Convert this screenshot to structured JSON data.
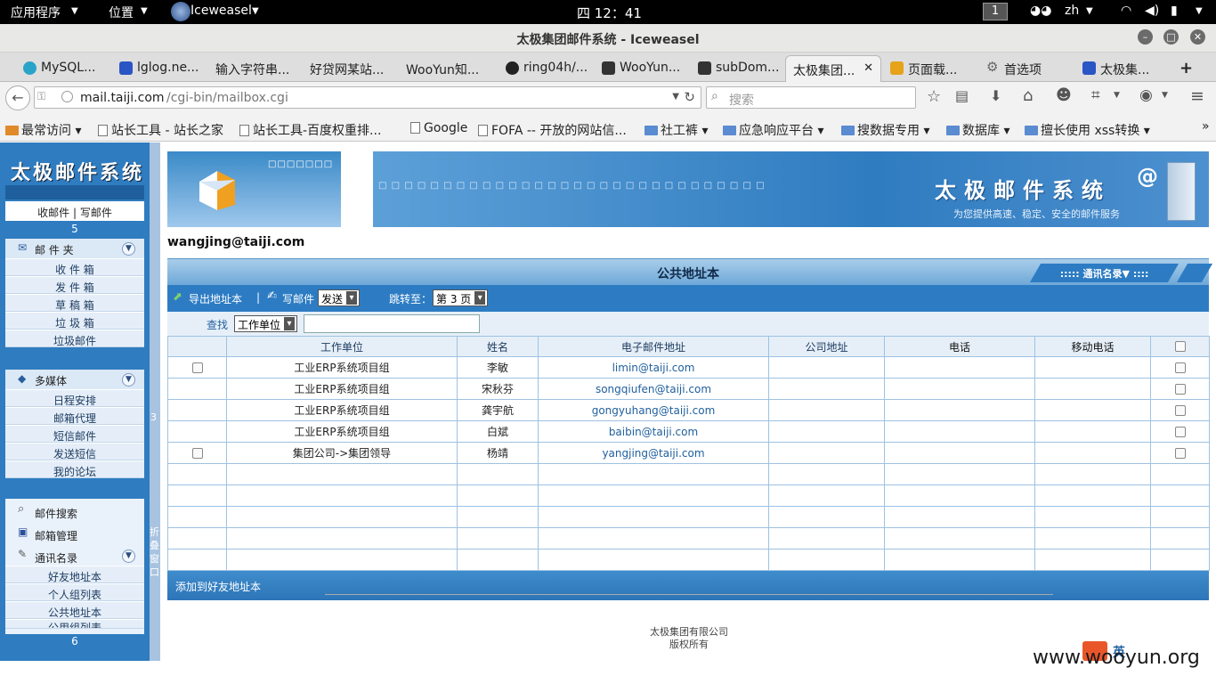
{
  "topbar": {
    "apps": "应用程序",
    "places": "位置",
    "app": "Iceweasel",
    "clock": "四 12：41",
    "workspace": "1",
    "lang": "zh"
  },
  "window": {
    "title": "太极集团邮件系统 - Iceweasel"
  },
  "tabs": [
    "MySQL...",
    "lglog.ne...",
    "输入字符串...",
    "好贷网某站...",
    "WooYun知...",
    "ring04h/...",
    "WooYun...",
    "subDom...",
    "太极集团...",
    "页面载...",
    "首选项",
    "太极集..."
  ],
  "nav": {
    "url_host": "mail.taiji.com",
    "url_path": "/cgi-bin/mailbox.cgi",
    "search_placeholder": "搜索"
  },
  "bookmarks": [
    "最常访问",
    "站长工具 - 站长之家",
    "站长工具-百度权重排...",
    "Google",
    "FOFA -- 开放的网站信...",
    "社工裤",
    "应急响应平台",
    "搜数据专用",
    "数据库",
    "擅长使用 xss转换"
  ],
  "sidebar": {
    "logo": "太极邮件系统",
    "quick": "收邮件 | 写邮件",
    "num1": "5",
    "folders_head": "邮 件 夹",
    "folders": [
      "收 件 箱",
      "发 件 箱",
      "草 稿 箱",
      "垃 圾 箱",
      "垃圾邮件"
    ],
    "media_head": "多媒体",
    "media": [
      "日程安排",
      "邮箱代理",
      "短信邮件",
      "发送短信",
      "我的论坛"
    ],
    "mail_search": "邮件搜索",
    "mailbox_manage": "邮箱管理",
    "contacts_head": "通讯名录",
    "contacts": [
      "好友地址本",
      "个人组列表",
      "公共地址本",
      "公用组列表"
    ],
    "num2": "6",
    "stripe_num": "3",
    "fold_label": "折叠窗口"
  },
  "banner": {
    "title": "太极邮件系统",
    "subtitle": "为您提供高速、稳定、安全的邮件服务",
    "left_boxes": "□□□□□□□",
    "right_boxes": "□ □ □ □ □ □ □ □ □ □ □ □ □ □ □ □ □ □ □ □ □ □ □ □ □ □ □ □ □ □"
  },
  "user": "wangjing@taiji.com",
  "addrbook": {
    "title": "公共地址本",
    "contacts_tab": "::::: 通讯名录▼ ::::",
    "export": "导出地址本",
    "compose": "写邮件",
    "send_option": "发送",
    "jump_label": "跳转至：",
    "page_option": "第 3 页",
    "find_label": "查找",
    "find_field": "工作单位",
    "columns": [
      "工作单位",
      "姓名",
      "电子邮件地址",
      "公司地址",
      "电话",
      "移动电话"
    ],
    "rows": [
      {
        "unit": "工业ERP系统项目组",
        "name": "李敏",
        "email": "limin@taiji.com"
      },
      {
        "unit": "工业ERP系统项目组",
        "name": "宋秋芬",
        "email": "songqiufen@taiji.com"
      },
      {
        "unit": "工业ERP系统项目组",
        "name": "龚宇航",
        "email": "gongyuhang@taiji.com"
      },
      {
        "unit": "工业ERP系统项目组",
        "name": "白斌",
        "email": "baibin@taiji.com"
      },
      {
        "unit": "集团公司->集团领导",
        "name": "杨靖",
        "email": "yangjing@taiji.com"
      }
    ],
    "add_to_friends": "添加到好友地址本"
  },
  "footer": {
    "company": "太极集团有限公司",
    "rights": "版权所有"
  },
  "watermark": "www.wooyun.org",
  "ime": "英"
}
